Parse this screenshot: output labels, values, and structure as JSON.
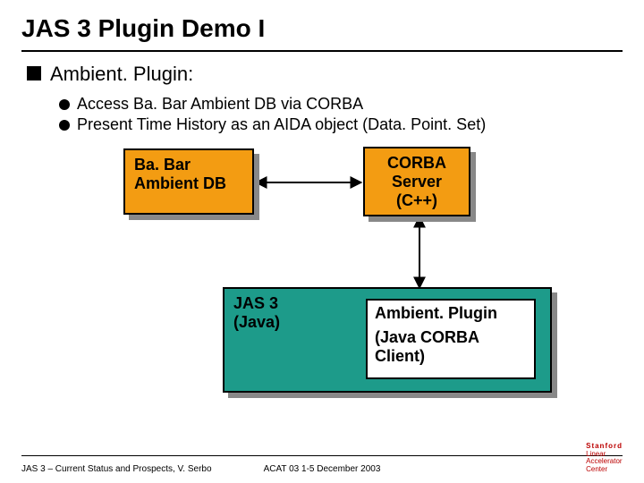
{
  "title": "JAS 3 Plugin Demo I",
  "bullet1": "Ambient. Plugin:",
  "subbullets": [
    "Access Ba. Bar Ambient DB via CORBA",
    "Present Time History as an AIDA object (Data. Point. Set)"
  ],
  "boxes": {
    "box1_line1": "Ba. Bar",
    "box1_line2": "Ambient DB",
    "box2_line1": "CORBA",
    "box2_line2": "Server",
    "box2_line3": "(C++)",
    "jas3_line1": "JAS 3",
    "jas3_line2": "(Java)",
    "plugin_line1": "Ambient. Plugin",
    "plugin_line2": "(Java CORBA",
    "plugin_line3": "Client)"
  },
  "footer": {
    "left": "JAS 3 – Current Status and Prospects,  V. Serbo",
    "center": "ACAT 03    1-5 December 2003",
    "logo_l1": "Stanford",
    "logo_l2": "Linear",
    "logo_l3": "Accelerator",
    "logo_l4": "Center"
  }
}
